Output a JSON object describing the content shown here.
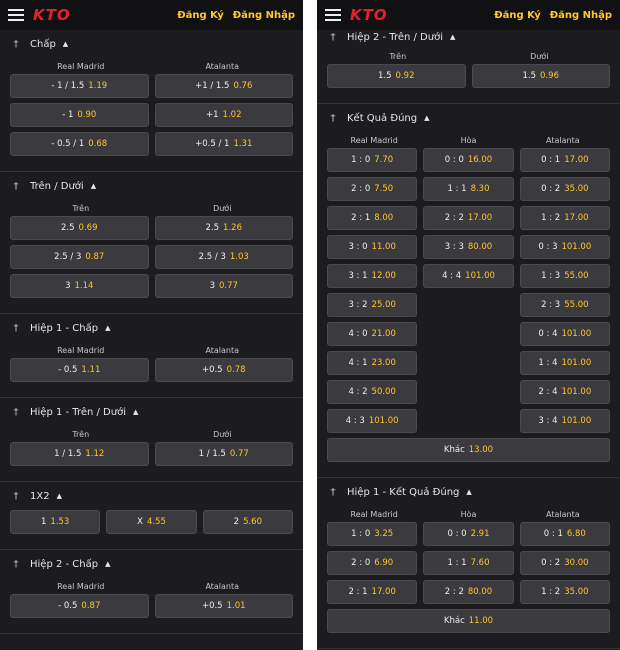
{
  "header": {
    "logo": "KTO",
    "register": "Đăng Ký",
    "login": "Đăng Nhập"
  },
  "left": {
    "markets": [
      {
        "id": "chap",
        "title": "Chấp",
        "columns": [
          "Real Madrid",
          "Atalanta"
        ],
        "rows": [
          [
            {
              "label": "- 1 / 1.5",
              "odd": "1.19"
            },
            {
              "label": "+1 / 1.5",
              "odd": "0.76"
            }
          ],
          [
            {
              "label": "- 1",
              "odd": "0.90"
            },
            {
              "label": "+1",
              "odd": "1.02"
            }
          ],
          [
            {
              "label": "- 0.5 / 1",
              "odd": "0.68"
            },
            {
              "label": "+0.5 / 1",
              "odd": "1.31"
            }
          ]
        ]
      },
      {
        "id": "tren-duoi",
        "title": "Trên / Dưới",
        "columns": [
          "Trên",
          "Dưới"
        ],
        "rows": [
          [
            {
              "label": "2.5",
              "odd": "0.69"
            },
            {
              "label": "2.5",
              "odd": "1.26"
            }
          ],
          [
            {
              "label": "2.5 / 3",
              "odd": "0.87"
            },
            {
              "label": "2.5 / 3",
              "odd": "1.03"
            }
          ],
          [
            {
              "label": "3",
              "odd": "1.14"
            },
            {
              "label": "3",
              "odd": "0.77"
            }
          ]
        ]
      },
      {
        "id": "hiep1-chap",
        "title": "Hiệp 1 - Chấp",
        "columns": [
          "Real Madrid",
          "Atalanta"
        ],
        "rows": [
          [
            {
              "label": "- 0.5",
              "odd": "1.11"
            },
            {
              "label": "+0.5",
              "odd": "0.78"
            }
          ]
        ]
      },
      {
        "id": "hiep1-tren-duoi",
        "title": "Hiệp 1 - Trên / Dưới",
        "columns": [
          "Trên",
          "Dưới"
        ],
        "rows": [
          [
            {
              "label": "1 / 1.5",
              "odd": "1.12"
            },
            {
              "label": "1 / 1.5",
              "odd": "0.77"
            }
          ]
        ]
      },
      {
        "id": "1x2",
        "title": "1X2",
        "columns": [],
        "rows": [
          [
            {
              "label": "1",
              "odd": "1.53"
            },
            {
              "label": "X",
              "odd": "4.55"
            },
            {
              "label": "2",
              "odd": "5.60"
            }
          ]
        ]
      },
      {
        "id": "hiep2-chap",
        "title": "Hiệp 2 - Chấp",
        "columns": [
          "Real Madrid",
          "Atalanta"
        ],
        "rows": [
          [
            {
              "label": "- 0.5",
              "odd": "0.87"
            },
            {
              "label": "+0.5",
              "odd": "1.01"
            }
          ]
        ]
      }
    ]
  },
  "right": {
    "markets": [
      {
        "id": "hiep2-tren-duoi",
        "title": "Hiệp 2 - Trên / Dưới",
        "columns": [
          "Trên",
          "Dưới"
        ],
        "rows": [
          [
            {
              "label": "1.5",
              "odd": "0.92"
            },
            {
              "label": "1.5",
              "odd": "0.96"
            }
          ]
        ]
      },
      {
        "id": "ket-qua-dung",
        "title": "Kết Quả Đúng",
        "columns": [
          "Real Madrid",
          "Hòa",
          "Atalanta"
        ],
        "rows": [
          [
            {
              "label": "1 : 0",
              "odd": "7.70"
            },
            {
              "label": "0 : 0",
              "odd": "16.00"
            },
            {
              "label": "0 : 1",
              "odd": "17.00"
            }
          ],
          [
            {
              "label": "2 : 0",
              "odd": "7.50"
            },
            {
              "label": "1 : 1",
              "odd": "8.30"
            },
            {
              "label": "0 : 2",
              "odd": "35.00"
            }
          ],
          [
            {
              "label": "2 : 1",
              "odd": "8.00"
            },
            {
              "label": "2 : 2",
              "odd": "17.00"
            },
            {
              "label": "1 : 2",
              "odd": "17.00"
            }
          ],
          [
            {
              "label": "3 : 0",
              "odd": "11.00"
            },
            {
              "label": "3 : 3",
              "odd": "80.00"
            },
            {
              "label": "0 : 3",
              "odd": "101.00"
            }
          ],
          [
            {
              "label": "3 : 1",
              "odd": "12.00"
            },
            {
              "label": "4 : 4",
              "odd": "101.00"
            },
            {
              "label": "1 : 3",
              "odd": "55.00"
            }
          ],
          [
            {
              "label": "3 : 2",
              "odd": "25.00"
            },
            null,
            {
              "label": "2 : 3",
              "odd": "55.00"
            }
          ],
          [
            {
              "label": "4 : 0",
              "odd": "21.00"
            },
            null,
            {
              "label": "0 : 4",
              "odd": "101.00"
            }
          ],
          [
            {
              "label": "4 : 1",
              "odd": "23.00"
            },
            null,
            {
              "label": "1 : 4",
              "odd": "101.00"
            }
          ],
          [
            {
              "label": "4 : 2",
              "odd": "50.00"
            },
            null,
            {
              "label": "2 : 4",
              "odd": "101.00"
            }
          ],
          [
            {
              "label": "4 : 3",
              "odd": "101.00"
            },
            null,
            {
              "label": "3 : 4",
              "odd": "101.00"
            }
          ]
        ],
        "other": {
          "label": "Khác",
          "odd": "13.00"
        }
      },
      {
        "id": "hiep1-ket-qua-dung",
        "title": "Hiệp 1 - Kết Quả Đúng",
        "columns": [
          "Real Madrid",
          "Hòa",
          "Atalanta"
        ],
        "rows": [
          [
            {
              "label": "1 : 0",
              "odd": "3.25"
            },
            {
              "label": "0 : 0",
              "odd": "2.91"
            },
            {
              "label": "0 : 1",
              "odd": "6.80"
            }
          ],
          [
            {
              "label": "2 : 0",
              "odd": "6.90"
            },
            {
              "label": "1 : 1",
              "odd": "7.60"
            },
            {
              "label": "0 : 2",
              "odd": "30.00"
            }
          ],
          [
            {
              "label": "2 : 1",
              "odd": "17.00"
            },
            {
              "label": "2 : 2",
              "odd": "80.00"
            },
            {
              "label": "1 : 2",
              "odd": "35.00"
            }
          ]
        ],
        "other": {
          "label": "Khác",
          "odd": "11.00"
        }
      }
    ]
  },
  "colors": {
    "background": "#1c1c1f",
    "header": "#111113",
    "button": "#3a3a3f",
    "odds": "#ffc72c",
    "logo": "#e8202a"
  },
  "icons": [
    "menu-icon",
    "pin-icon",
    "caret-up-icon"
  ]
}
